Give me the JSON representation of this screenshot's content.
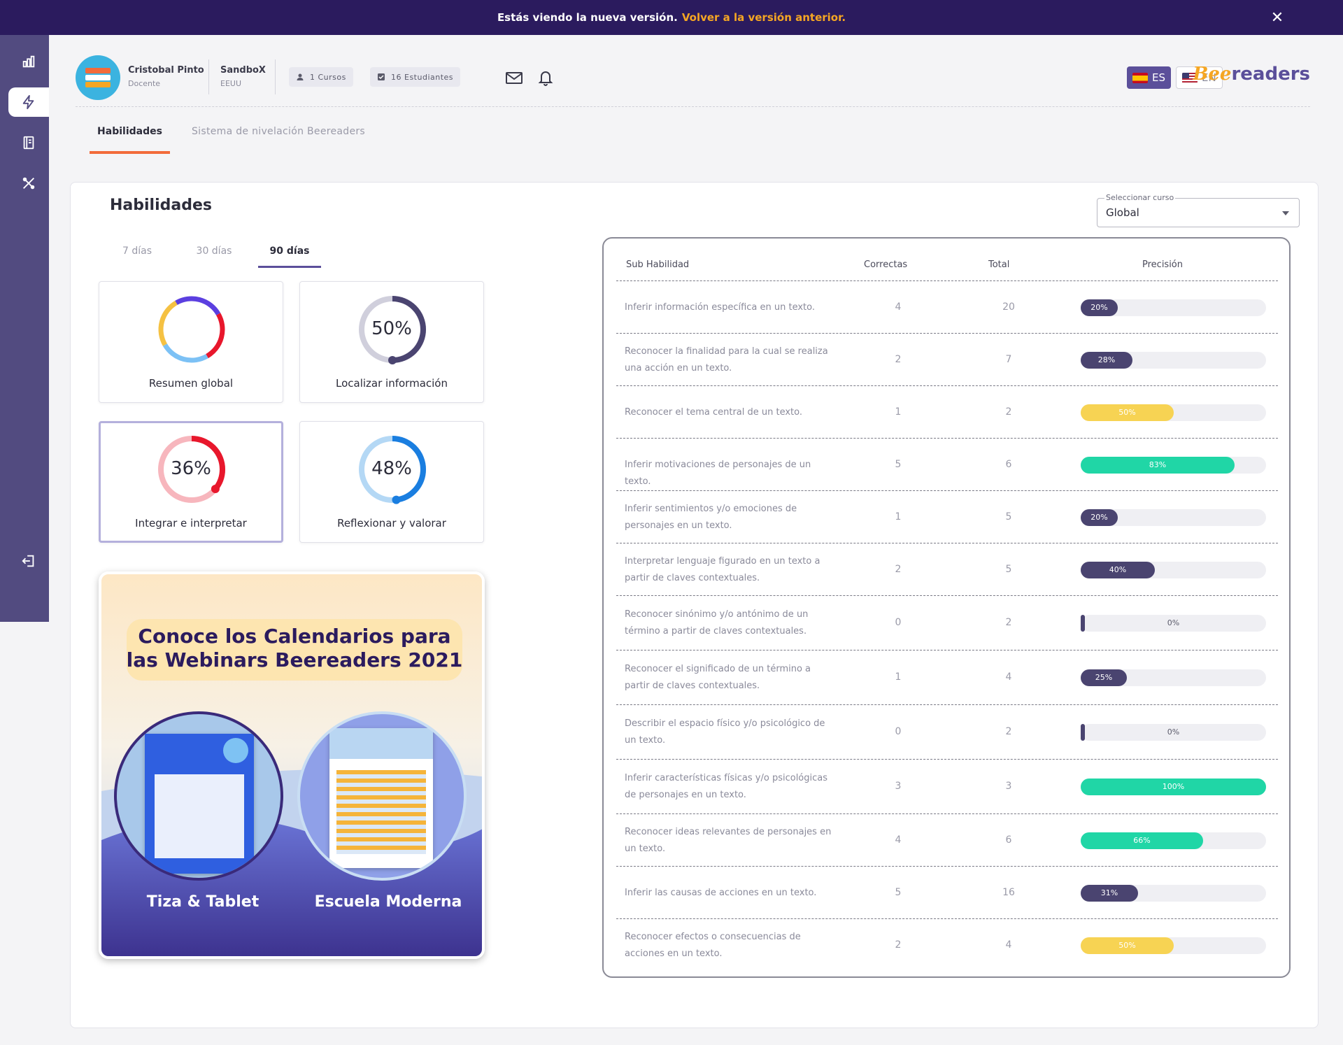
{
  "banner": {
    "text": "Estás viendo la nueva versión.",
    "link": "Volver a la versión anterior.",
    "close": "✕"
  },
  "header": {
    "user_name": "Cristobal Pinto",
    "user_role": "Docente",
    "school_name": "SandboX",
    "school_country": "EEUU",
    "chip_courses": "1 Cursos",
    "chip_students": "16 Estudiantes",
    "lang_es": "ES",
    "lang_en": "EN",
    "logo_bee": "Bee",
    "logo_rest": "readers"
  },
  "page_tabs": {
    "habilidades": "Habilidades",
    "nivelacion": "Sistema de nivelación Beereaders"
  },
  "main": {
    "title": "Habilidades",
    "select_label": "Seleccionar curso",
    "select_value": "Global",
    "range_tabs": [
      "7 días",
      "30 días",
      "90 días"
    ],
    "active_range": "90 días"
  },
  "skills": [
    {
      "caption": "Resumen global",
      "pct": "",
      "value": null,
      "color": "#5b4f9a"
    },
    {
      "caption": "Localizar información",
      "pct": "50%",
      "value": 0.5,
      "color": "#4a4470",
      "track": "#d0cfdc"
    },
    {
      "caption": "Integrar e interpretar",
      "pct": "36%",
      "value": 0.36,
      "color": "#e8172c",
      "track": "#f7b6bd"
    },
    {
      "caption": "Reflexionar y valorar",
      "pct": "48%",
      "value": 0.48,
      "color": "#1a7ee0",
      "track": "#b4d8f5"
    }
  ],
  "promo": {
    "heading_line1": "Conoce los Calendarios para",
    "heading_line2": "las Webinars Beereaders 2021",
    "label_left": "Tiza & Tablet",
    "label_right": "Escuela Moderna"
  },
  "table": {
    "headers": {
      "sub": "Sub Habilidad",
      "correct": "Correctas",
      "total": "Total",
      "precision": "Precisión"
    },
    "rows": [
      {
        "name": "Inferir información específica en un texto.",
        "correct": "4",
        "total": "20",
        "pct": "20%",
        "value": 0.2,
        "color": "#4a4470"
      },
      {
        "name": "Reconocer la finalidad para la cual se realiza una acción en un texto.",
        "correct": "2",
        "total": "7",
        "pct": "28%",
        "value": 0.28,
        "color": "#4a4470"
      },
      {
        "name": "Reconocer el tema central de un texto.",
        "correct": "1",
        "total": "2",
        "pct": "50%",
        "value": 0.5,
        "color": "#f7d353"
      },
      {
        "name": "Inferir motivaciones de personajes de un texto.",
        "correct": "5",
        "total": "6",
        "pct": "83%",
        "value": 0.83,
        "color": "#20d6a6"
      },
      {
        "name": "Inferir sentimientos y/o emociones de personajes en un texto.",
        "correct": "1",
        "total": "5",
        "pct": "20%",
        "value": 0.2,
        "color": "#4a4470"
      },
      {
        "name": "Interpretar lenguaje figurado en un texto a partir de claves contextuales.",
        "correct": "2",
        "total": "5",
        "pct": "40%",
        "value": 0.4,
        "color": "#4a4470"
      },
      {
        "name": "Reconocer sinónimo y/o antónimo de un término a partir de claves contextuales.",
        "correct": "0",
        "total": "2",
        "pct": "0%",
        "value": 0.0,
        "color": "#4a4470"
      },
      {
        "name": "Reconocer el significado de un término a partir de claves contextuales.",
        "correct": "1",
        "total": "4",
        "pct": "25%",
        "value": 0.25,
        "color": "#4a4470"
      },
      {
        "name": "Describir el espacio físico y/o psicológico de un texto.",
        "correct": "0",
        "total": "2",
        "pct": "0%",
        "value": 0.0,
        "color": "#4a4470"
      },
      {
        "name": "Inferir características físicas y/o psicológicas de personajes en un texto.",
        "correct": "3",
        "total": "3",
        "pct": "100%",
        "value": 1.0,
        "color": "#20d6a6"
      },
      {
        "name": "Reconocer ideas relevantes de personajes en un texto.",
        "correct": "4",
        "total": "6",
        "pct": "66%",
        "value": 0.66,
        "color": "#20d6a6"
      },
      {
        "name": "Inferir las causas de acciones en un texto.",
        "correct": "5",
        "total": "16",
        "pct": "31%",
        "value": 0.31,
        "color": "#4a4470"
      },
      {
        "name": "Reconocer efectos o consecuencias de acciones en un texto.",
        "correct": "2",
        "total": "4",
        "pct": "50%",
        "value": 0.5,
        "color": "#f7d353"
      }
    ]
  }
}
